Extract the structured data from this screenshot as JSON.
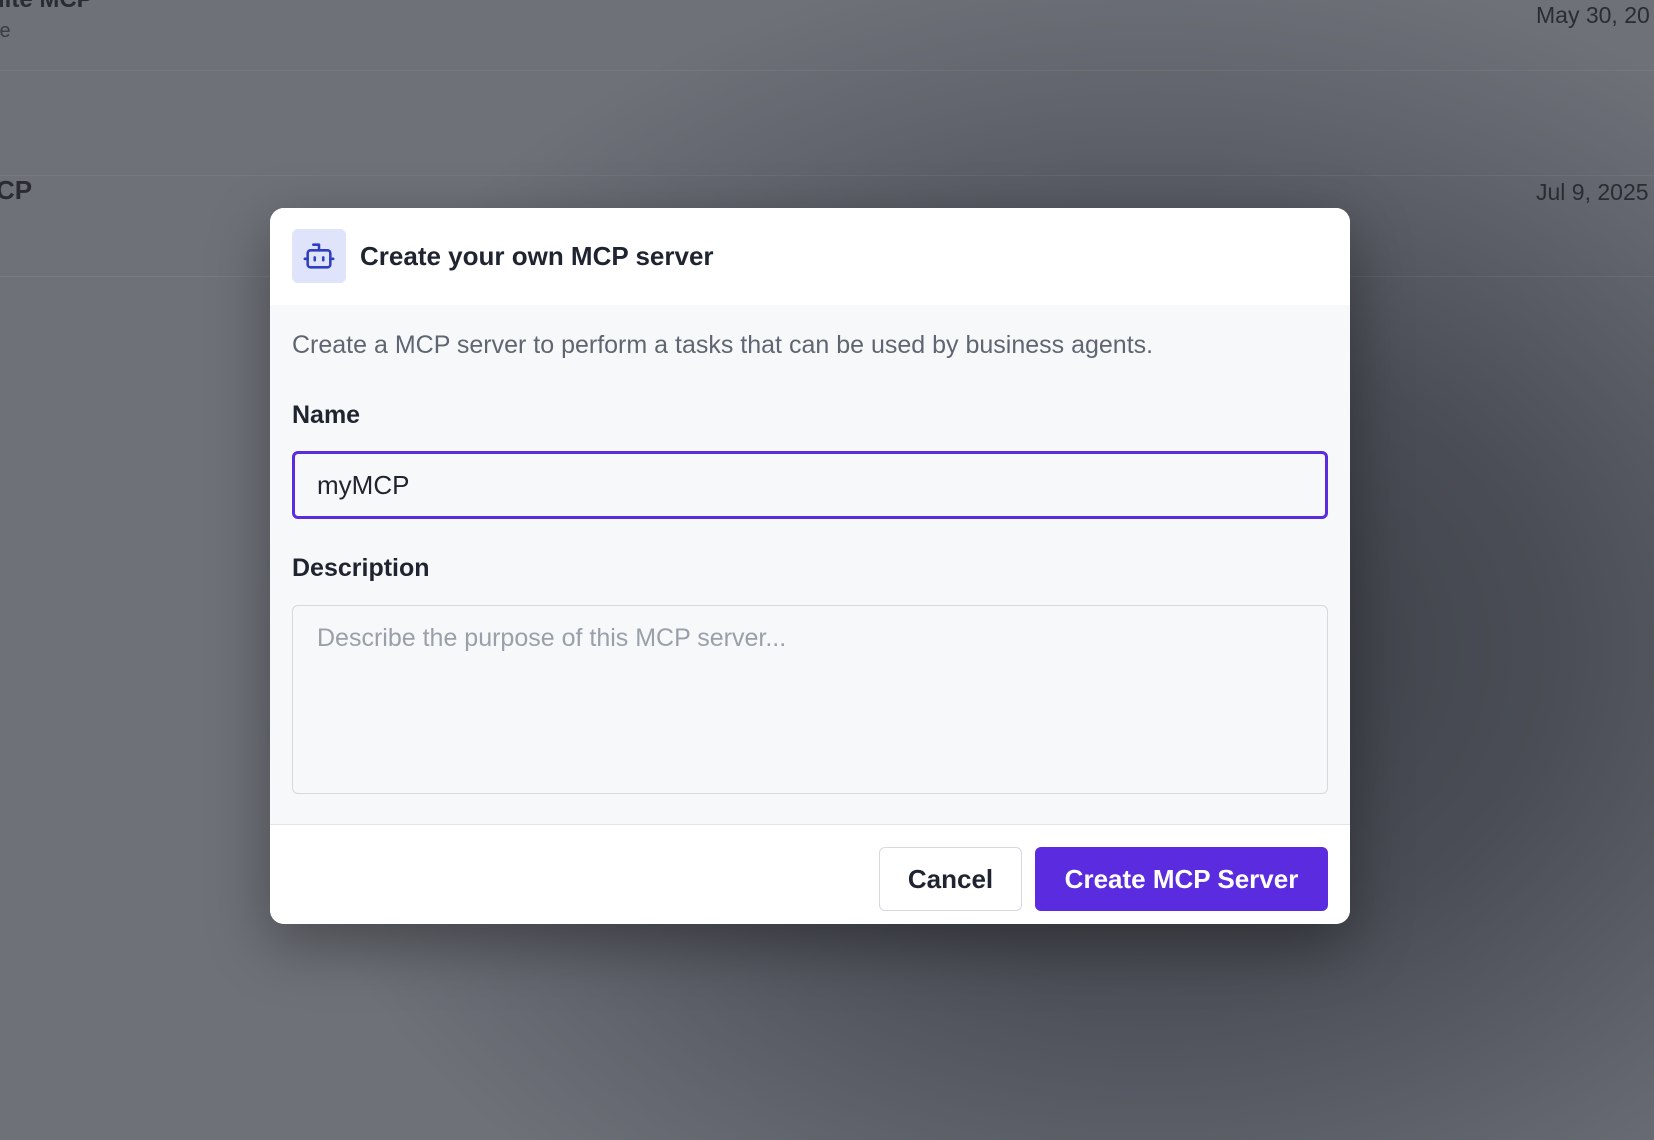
{
  "background": {
    "rows": [
      {
        "title": "uite MCP",
        "subtitle": "te",
        "date": "May 30, 20"
      },
      {
        "title": "CP",
        "date": "Jul 9, 2025"
      }
    ]
  },
  "dialog": {
    "icon": "robot-icon",
    "title": "Create your own MCP server",
    "description": "Create a MCP server to perform a tasks that can be used by business agents.",
    "name_label": "Name",
    "name_value": "myMCP",
    "description_label": "Description",
    "description_placeholder": "Describe the purpose of this MCP server...",
    "cancel_label": "Cancel",
    "create_label": "Create MCP Server"
  },
  "colors": {
    "accent": "#5b2be0",
    "icon_bg": "#dfe4fb",
    "icon_stroke": "#2f3fbf",
    "overlay": "#4a4d55"
  }
}
